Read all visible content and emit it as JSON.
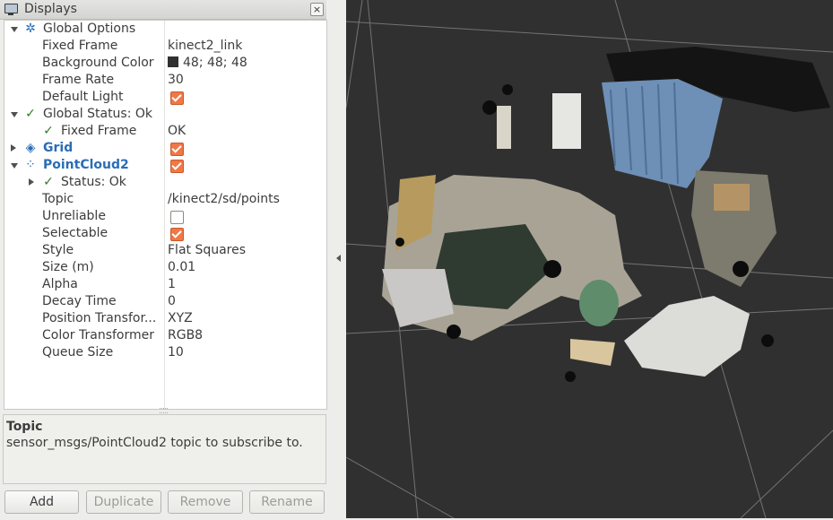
{
  "panel": {
    "title": "Displays",
    "close_label": "×"
  },
  "tree": [
    {
      "label": "Global Options",
      "value": "",
      "icon": "gear-icon",
      "icon_glyph": "✲",
      "arrow": "down",
      "indent": 0
    },
    {
      "label": "Fixed Frame",
      "value": "kinect2_link",
      "arrow": "",
      "indent": 1
    },
    {
      "label": "Background Color",
      "value": "48; 48; 48",
      "swatch": "#303030",
      "arrow": "",
      "indent": 1
    },
    {
      "label": "Frame Rate",
      "value": "30",
      "arrow": "",
      "indent": 1
    },
    {
      "label": "Default Light",
      "value": "",
      "checkbox": true,
      "arrow": "",
      "indent": 1
    },
    {
      "label": "Global Status: Ok",
      "value": "",
      "icon": "check-icon",
      "icon_glyph": "✓",
      "arrow": "down",
      "indent": 0
    },
    {
      "label": "Fixed Frame",
      "value": "OK",
      "icon": "check-icon",
      "icon_glyph": "✓",
      "arrow": "",
      "indent": 1
    },
    {
      "label": "Grid",
      "value": "",
      "checkbox": true,
      "icon": "grid-icon",
      "icon_glyph": "◈",
      "arrow": "right",
      "indent": 0,
      "style": "blue"
    },
    {
      "label": "PointCloud2",
      "value": "",
      "checkbox": true,
      "icon": "pointcloud-icon",
      "icon_glyph": "⁘",
      "arrow": "down",
      "indent": 0,
      "style": "blue"
    },
    {
      "label": "Status: Ok",
      "value": "",
      "icon": "check-icon",
      "icon_glyph": "✓",
      "arrow": "right",
      "indent": 1
    },
    {
      "label": "Topic",
      "value": "/kinect2/sd/points",
      "arrow": "",
      "indent": 1
    },
    {
      "label": "Unreliable",
      "value": "",
      "checkbox": false,
      "arrow": "",
      "indent": 1
    },
    {
      "label": "Selectable",
      "value": "",
      "checkbox": true,
      "arrow": "",
      "indent": 1
    },
    {
      "label": "Style",
      "value": "Flat Squares",
      "arrow": "",
      "indent": 1
    },
    {
      "label": "Size (m)",
      "value": "0.01",
      "arrow": "",
      "indent": 1
    },
    {
      "label": "Alpha",
      "value": "1",
      "arrow": "",
      "indent": 1
    },
    {
      "label": "Decay Time",
      "value": "0",
      "arrow": "",
      "indent": 1
    },
    {
      "label": "Position Transfor...",
      "value": "XYZ",
      "arrow": "",
      "indent": 1
    },
    {
      "label": "Color Transformer",
      "value": "RGB8",
      "arrow": "",
      "indent": 1
    },
    {
      "label": "Queue Size",
      "value": "10",
      "arrow": "",
      "indent": 1
    }
  ],
  "description": {
    "title": "Topic",
    "text": "sensor_msgs/PointCloud2 topic to subscribe to."
  },
  "buttons": {
    "add": "Add",
    "duplicate": "Duplicate",
    "remove": "Remove",
    "rename": "Rename"
  },
  "colors": {
    "background": "#303030",
    "checkbox_accent": "#f07746",
    "display_name": "#2a6db5",
    "ok_check": "#2e7d22"
  }
}
